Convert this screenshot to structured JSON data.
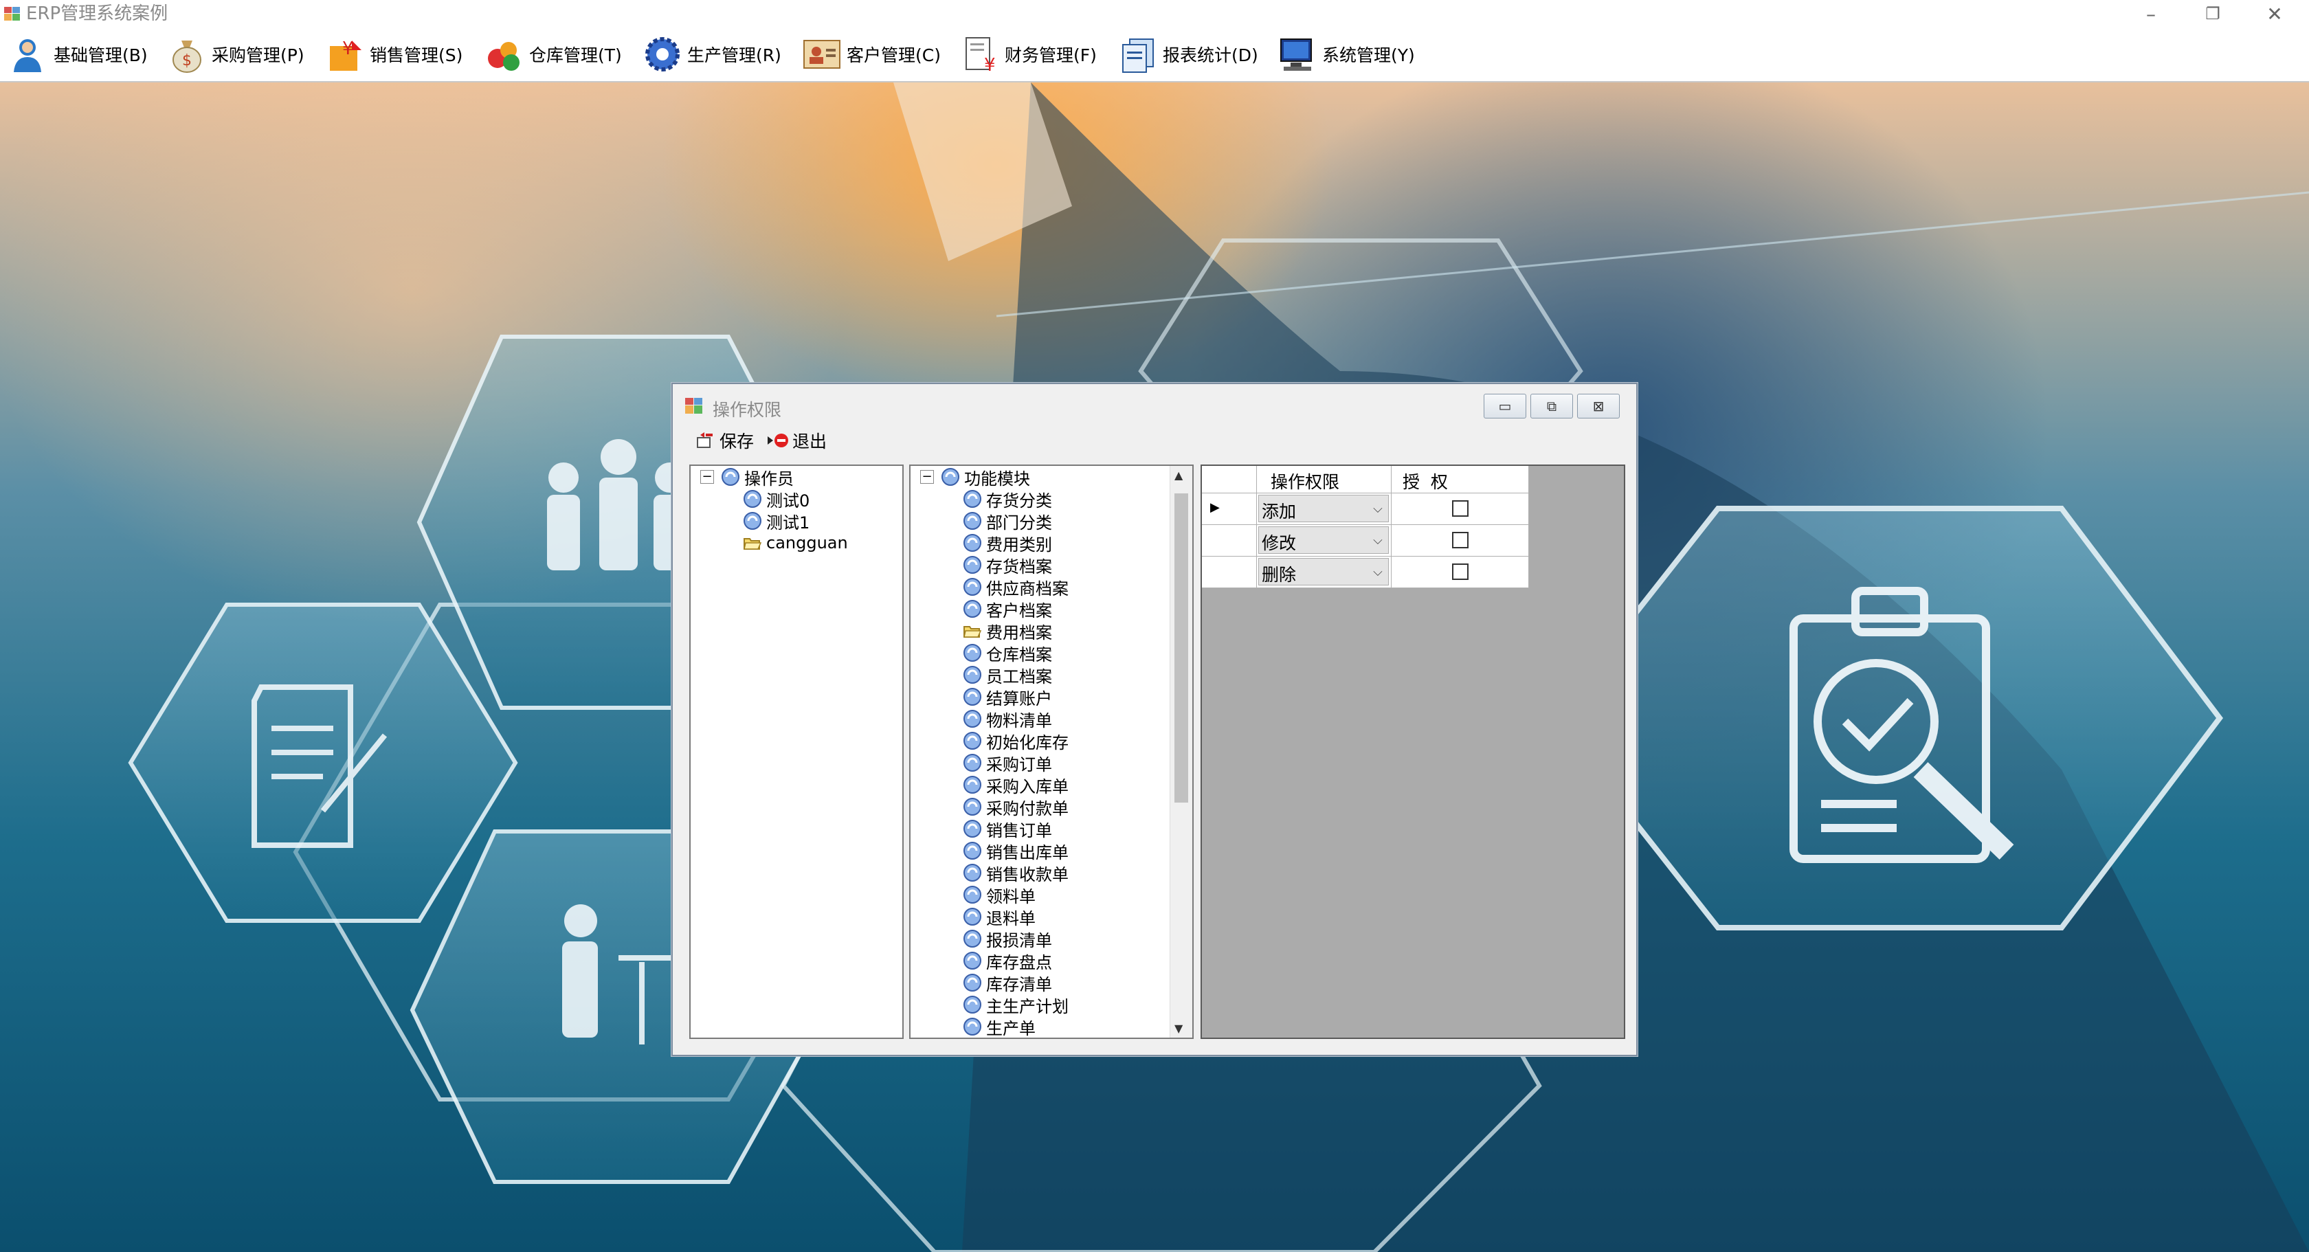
{
  "app": {
    "title": "ERP管理系统案例"
  },
  "window_controls": {
    "minimize": "–",
    "restore": "❐",
    "close": "✕"
  },
  "menu": [
    {
      "label": "基础管理(B)",
      "icon": "user-icon"
    },
    {
      "label": "采购管理(P)",
      "icon": "money-bag-icon"
    },
    {
      "label": "销售管理(S)",
      "icon": "yen-sale-icon"
    },
    {
      "label": "仓库管理(T)",
      "icon": "warehouse-boxes-icon"
    },
    {
      "label": "生产管理(R)",
      "icon": "gear-icon"
    },
    {
      "label": "客户管理(C)",
      "icon": "customer-card-icon"
    },
    {
      "label": "财务管理(F)",
      "icon": "finance-document-icon"
    },
    {
      "label": "报表统计(D)",
      "icon": "report-icon"
    },
    {
      "label": "系统管理(Y)",
      "icon": "computer-icon"
    }
  ],
  "dialog": {
    "title": "操作权限",
    "toolbar": {
      "save": "保存",
      "exit": "退出"
    },
    "operators": {
      "root": "操作员",
      "children": [
        "测试0",
        "测试1",
        "cangguan"
      ]
    },
    "modules": {
      "root": "功能模块",
      "children": [
        "存货分类",
        "部门分类",
        "费用类别",
        "存货档案",
        "供应商档案",
        "客户档案",
        "费用档案",
        "仓库档案",
        "员工档案",
        "结算账户",
        "物料清单",
        "初始化库存",
        "采购订单",
        "采购入库单",
        "采购付款单",
        "销售订单",
        "销售出库单",
        "销售收款单",
        "领料单",
        "退料单",
        "报损清单",
        "库存盘点",
        "库存清单",
        "主生产计划",
        "生产单"
      ],
      "selected_index": 6
    },
    "grid": {
      "columns": [
        "操作权限",
        "授  权"
      ],
      "rows": [
        {
          "permission": "添加",
          "granted": false,
          "current": true
        },
        {
          "permission": "修改",
          "granted": false,
          "current": false
        },
        {
          "permission": "删除",
          "granted": false,
          "current": false
        }
      ]
    }
  }
}
